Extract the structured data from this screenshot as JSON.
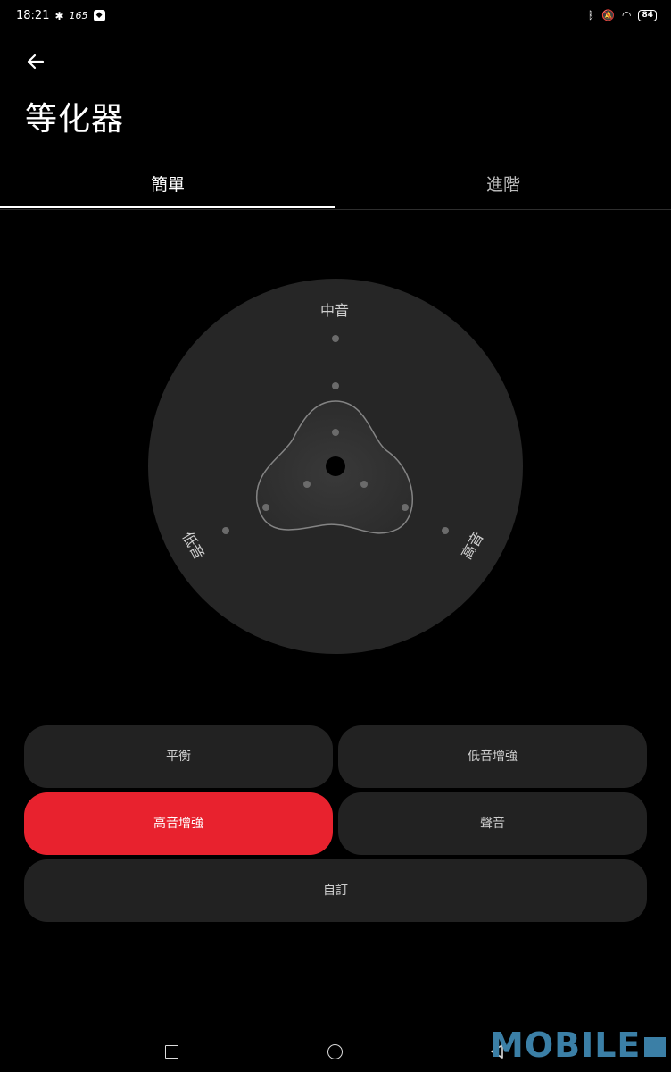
{
  "status_bar": {
    "time": "18:21",
    "rate": "165",
    "battery": "84",
    "icons": [
      "fan-icon",
      "app-badge-icon",
      "bluetooth-icon",
      "mute-icon",
      "wifi-icon",
      "battery-icon"
    ]
  },
  "header": {
    "back_icon": "arrow-left-icon",
    "title": "等化器"
  },
  "tabs": [
    {
      "label": "簡單",
      "selected": true
    },
    {
      "label": "進階",
      "selected": false
    }
  ],
  "equalizer": {
    "labels": {
      "mid": "中音",
      "bass": "低音",
      "treble": "高音"
    },
    "accent_disc_color": "#262626"
  },
  "presets": [
    {
      "label": "平衡",
      "selected": false
    },
    {
      "label": "低音增強",
      "selected": false
    },
    {
      "label": "高音增強",
      "selected": true
    },
    {
      "label": "聲音",
      "selected": false
    },
    {
      "label": "自訂",
      "selected": false
    }
  ],
  "colors": {
    "accent": "#e8222e",
    "background": "#000000",
    "button": "#222222"
  },
  "nav_bar": {
    "icons": [
      "recent-apps-icon",
      "home-icon",
      "back-triangle-icon"
    ]
  },
  "watermark": {
    "text": "MOBILE"
  }
}
